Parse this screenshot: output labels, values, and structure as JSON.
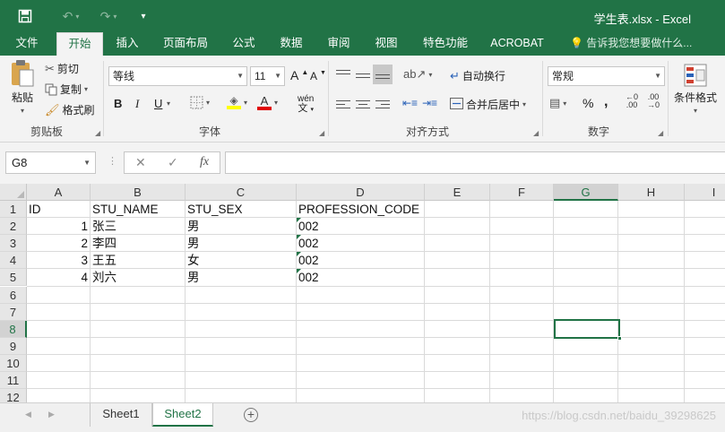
{
  "window": {
    "title": "学生表.xlsx - Excel",
    "quick_access": {
      "save_icon": "save-icon",
      "undo_icon": "undo-icon",
      "redo_icon": "redo-icon",
      "customize_icon": "customize-icon"
    }
  },
  "tabs": [
    {
      "label": "文件"
    },
    {
      "label": "开始"
    },
    {
      "label": "插入"
    },
    {
      "label": "页面布局"
    },
    {
      "label": "公式"
    },
    {
      "label": "数据"
    },
    {
      "label": "审阅"
    },
    {
      "label": "视图"
    },
    {
      "label": "特色功能"
    },
    {
      "label": "ACROBAT"
    }
  ],
  "tell_me": "告诉我您想要做什么...",
  "ribbon": {
    "clipboard": {
      "paste": "粘贴",
      "cut": "剪切",
      "copy": "复制",
      "format_painter": "格式刷",
      "label": "剪贴板"
    },
    "font": {
      "name": "等线",
      "size": "11",
      "grow": "A",
      "shrink": "A",
      "bold": "B",
      "italic": "I",
      "underline": "U",
      "font_color_letter": "A",
      "phonetic": "wén",
      "label": "字体"
    },
    "alignment": {
      "wrap_text": "自动换行",
      "merge_center": "合并后居中",
      "label": "对齐方式"
    },
    "number": {
      "format": "常规",
      "percent": "%",
      "comma": ",",
      "inc_decimal": ".00",
      "dec_decimal": ".00",
      "label": "数字"
    },
    "styles": {
      "conditional": "条件格式"
    }
  },
  "formula_bar": {
    "name_box": "G8",
    "cancel": "✕",
    "enter": "✓",
    "fx": "fx",
    "value": ""
  },
  "sheet": {
    "columns": [
      "A",
      "B",
      "C",
      "D",
      "E",
      "F",
      "G",
      "H",
      "I"
    ],
    "rows": [
      "1",
      "2",
      "3",
      "4",
      "5",
      "6",
      "7",
      "8",
      "9",
      "10",
      "11",
      "12"
    ],
    "selected_cell": "G8",
    "header_row": [
      "ID",
      "STU_NAME",
      "STU_SEX",
      "PROFESSION_CODE"
    ],
    "data": [
      [
        "1",
        "张三",
        "男",
        "002"
      ],
      [
        "2",
        "李四",
        "男",
        "002"
      ],
      [
        "3",
        "王五",
        "女",
        "002"
      ],
      [
        "4",
        "刘六",
        "男",
        "002"
      ]
    ]
  },
  "sheets": [
    {
      "label": "Sheet1"
    },
    {
      "label": "Sheet2"
    }
  ],
  "active_sheet": "Sheet2",
  "watermark": "https://blog.csdn.net/baidu_39298625",
  "colors": {
    "accent": "#217346"
  }
}
